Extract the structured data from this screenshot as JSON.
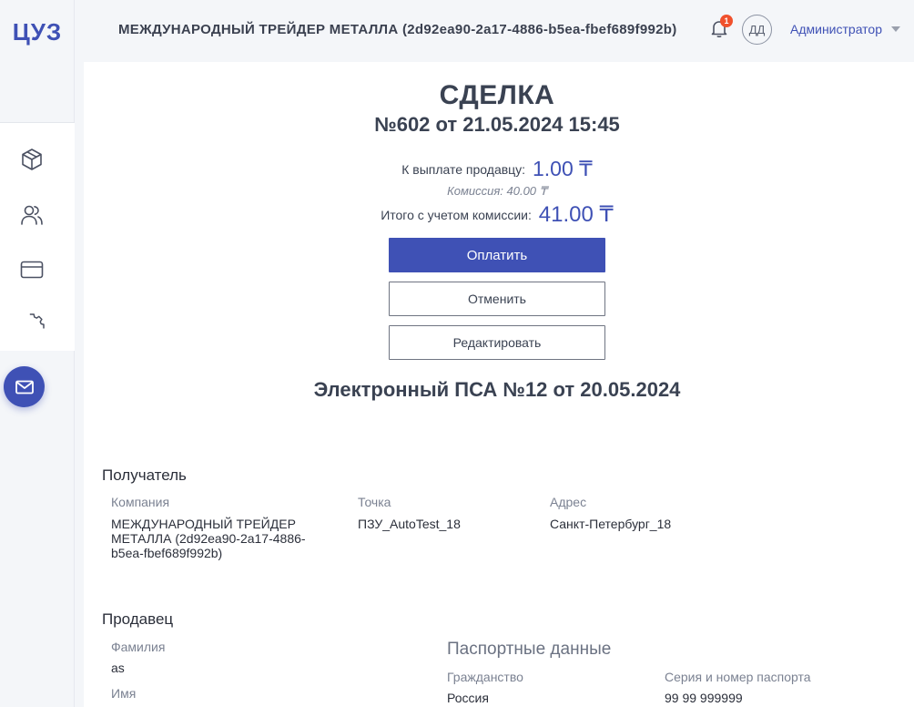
{
  "app": {
    "logo": "ЦУЗ"
  },
  "sidebar": {
    "items": [
      {
        "icon": "box-icon"
      },
      {
        "icon": "users-icon"
      },
      {
        "icon": "card-icon"
      },
      {
        "icon": "settings-icon"
      }
    ],
    "mail_icon": "mail-icon"
  },
  "header": {
    "org_title": "МЕЖДУНАРОДНЫЙ ТРЕЙДЕР МЕТАЛЛА (2d92ea90-2a17-4886-b5ea-fbef689f992b)",
    "notifications_count": "1",
    "avatar_initials": "ДД",
    "user_role": "Администратор"
  },
  "deal": {
    "title": "СДЕЛКА",
    "subtitle": "№602 от 21.05.2024 15:45",
    "pay_seller_label": "К выплате продавцу:",
    "pay_seller_amount": "1.00 ₸",
    "commission": "Комиссия: 40.00 ₸",
    "total_label": "Итого с учетом комиссии:",
    "total_amount": "41.00 ₸",
    "pay_button": "Оплатить",
    "cancel_button": "Отменить",
    "edit_button": "Редактировать"
  },
  "psa": {
    "title": "Электронный ПСА №12 от 20.05.2024"
  },
  "recipient": {
    "heading": "Получатель",
    "company_label": "Компания",
    "company_value": "МЕЖДУНАРОДНЫЙ ТРЕЙДЕР МЕТАЛЛА (2d92ea90-2a17-4886-b5ea-fbef689f992b)",
    "point_label": "Точка",
    "point_value": "ПЗУ_AutoTest_18",
    "address_label": "Адрес",
    "address_value": "Санкт-Петербург_18"
  },
  "seller": {
    "heading": "Продавец",
    "surname_label": "Фамилия",
    "surname_value": "as",
    "name_label": "Имя",
    "passport_heading": "Паспортные данные",
    "citizenship_label": "Гражданство",
    "citizenship_value": "Россия",
    "passport_label": "Серия и номер паспорта",
    "passport_value": "99 99 999999"
  },
  "colors": {
    "accent": "#3f51b5",
    "badge": "#f0512d"
  }
}
